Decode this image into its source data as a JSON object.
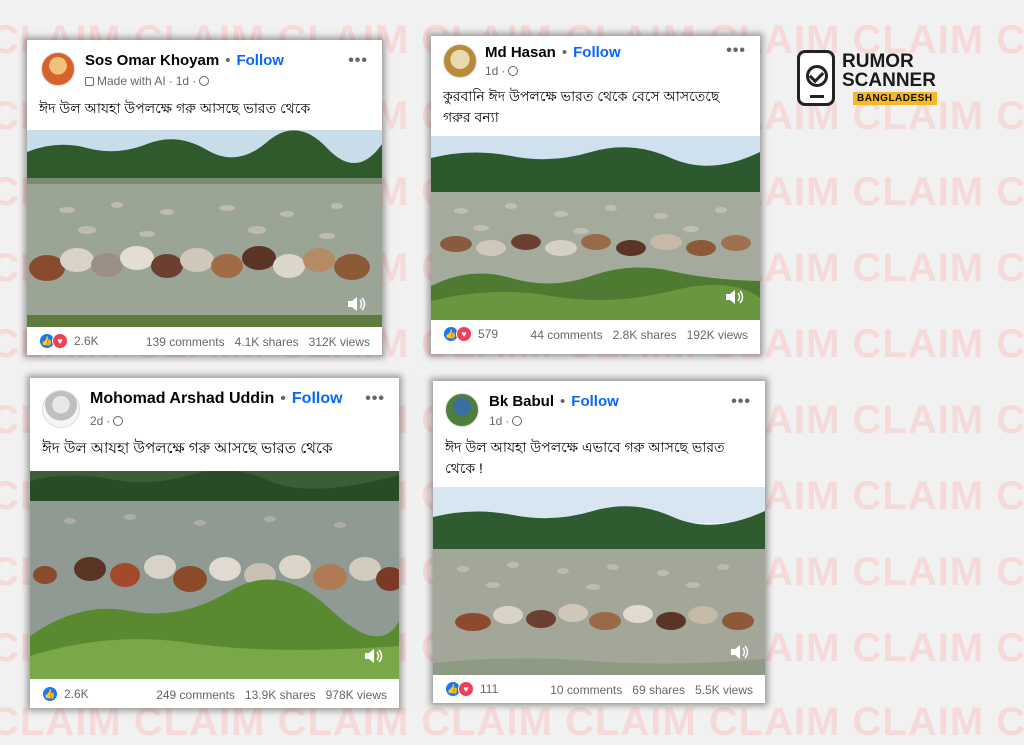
{
  "watermark": {
    "text": "CLAIM CLAIM CLAIM CLAIM CLAIM CLAIM CLAIM CLAIM",
    "color": "#f6dada"
  },
  "logo": {
    "line1": "RUMOR",
    "line2": "SCANNER",
    "line3": "BANGLADESH",
    "icon": "phone-check-icon"
  },
  "posts": [
    {
      "author": "Sos Omar Khoyam",
      "follow": "Follow",
      "ai_label": "Made with AI",
      "time": "1d",
      "caption": "ঈদ উল আযহা উপলক্ষে গরু আসছে ভারত থেকে",
      "reactions": "2.6K",
      "comments": "139 comments",
      "shares": "4.1K shares",
      "views": "312K views",
      "reaction_icons": [
        "like",
        "love"
      ]
    },
    {
      "author": "Md Hasan",
      "follow": "Follow",
      "time": "1d",
      "caption": "কুরবানি ঈদ উপলক্ষে ভারত থেকে বেসে আসতেছে গরুর বন্যা",
      "reactions": "579",
      "comments": "44 comments",
      "shares": "2.8K shares",
      "views": "192K views",
      "reaction_icons": [
        "like",
        "love"
      ]
    },
    {
      "author": "Mohomad Arshad Uddin",
      "follow": "Follow",
      "time": "2d",
      "caption": "ঈদ উল আযহা উপলক্ষে গরু আসছে ভারত থেকে",
      "reactions": "2.6K",
      "comments": "249 comments",
      "shares": "13.9K shares",
      "views": "978K views",
      "reaction_icons": [
        "like"
      ]
    },
    {
      "author": "Bk Babul",
      "follow": "Follow",
      "time": "1d",
      "caption": "ঈদ উল আযহা উপলক্ষে এভাবে গরু আসছে ভারত থেকে !",
      "reactions": "111",
      "comments": "10 comments",
      "shares": "69 shares",
      "views": "5.5K views",
      "reaction_icons": [
        "like",
        "love"
      ]
    }
  ],
  "colors": {
    "follow": "#0866ff",
    "like": "#1877f2",
    "love": "#f33e58",
    "logo_badge": "#f3b823"
  }
}
